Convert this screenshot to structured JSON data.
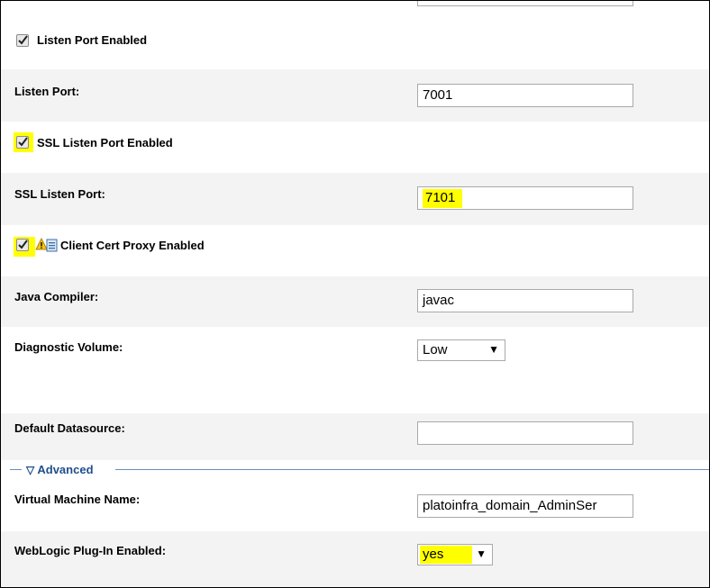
{
  "fields": {
    "listen_port_enabled": {
      "label": "Listen Port Enabled",
      "checked": true
    },
    "listen_port": {
      "label": "Listen Port:",
      "value": "7001"
    },
    "ssl_listen_port_enabled": {
      "label": "SSL Listen Port Enabled",
      "checked": true
    },
    "ssl_listen_port": {
      "label": "SSL Listen Port:",
      "value": "7101"
    },
    "client_cert_proxy_enabled": {
      "label": "Client Cert Proxy Enabled",
      "checked": true
    },
    "java_compiler": {
      "label": "Java Compiler:",
      "value": "javac"
    },
    "diagnostic_volume": {
      "label": "Diagnostic Volume:",
      "value": "Low"
    },
    "default_datasource": {
      "label": "Default Datasource:",
      "value": ""
    }
  },
  "advanced": {
    "label": "Advanced",
    "virtual_machine_name": {
      "label": "Virtual Machine Name:",
      "value": "platoinfra_domain_AdminSer"
    },
    "weblogic_plugin_enabled": {
      "label": "WebLogic Plug-In Enabled:",
      "value": "yes"
    }
  },
  "icons": {
    "dropdown": "▼",
    "collapse": "▽"
  },
  "colors": {
    "highlight": "#ffff00",
    "advanced_link": "#1f4f8f",
    "row_alt": "#f3f3f3"
  }
}
